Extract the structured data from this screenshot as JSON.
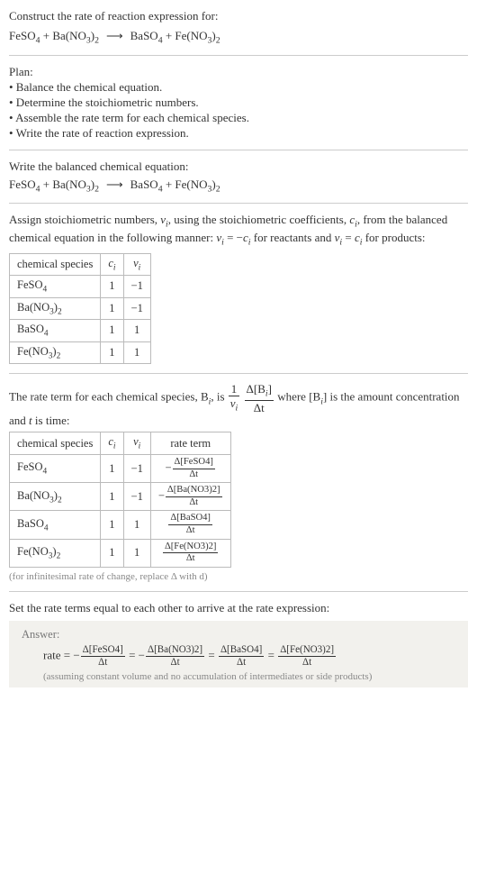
{
  "header": {
    "prompt": "Construct the rate of reaction expression for:"
  },
  "reaction": {
    "r1": "FeSO",
    "r1s": "4",
    "r2": "Ba(NO",
    "r2s": "3",
    "r2b": ")",
    "r2s2": "2",
    "p1": "BaSO",
    "p1s": "4",
    "p2": "Fe(NO",
    "p2s": "3",
    "p2b": ")",
    "p2s2": "2",
    "plus": " + ",
    "arrow": "⟶"
  },
  "plan": {
    "title": "Plan:",
    "b1": "• Balance the chemical equation.",
    "b2": "• Determine the stoichiometric numbers.",
    "b3": "• Assemble the rate term for each chemical species.",
    "b4": "• Write the rate of reaction expression."
  },
  "balanced_label": "Write the balanced chemical equation:",
  "stoich_para": {
    "t1": "Assign stoichiometric numbers, ",
    "nu": "ν",
    "i": "i",
    "t2": ", using the stoichiometric coefficients, ",
    "c": "c",
    "t3": ", from the balanced chemical equation in the following manner: ",
    "eq1a": " = −",
    "t4": " for reactants and ",
    "eq2a": " = ",
    "t5": " for products:"
  },
  "table1": {
    "h1": "chemical species",
    "h2": "c",
    "h2s": "i",
    "h3": "ν",
    "h3s": "i",
    "r": [
      {
        "sp": "FeSO",
        "sps": "4",
        "c": "1",
        "nu": "−1"
      },
      {
        "sp": "Ba(NO",
        "sps": "3",
        "spb": ")",
        "sps2": "2",
        "c": "1",
        "nu": "−1"
      },
      {
        "sp": "BaSO",
        "sps": "4",
        "c": "1",
        "nu": "1"
      },
      {
        "sp": "Fe(NO",
        "sps": "3",
        "spb": ")",
        "sps2": "2",
        "c": "1",
        "nu": "1"
      }
    ]
  },
  "rate_para": {
    "t1": "The rate term for each chemical species, B",
    "t2": ", is ",
    "one": "1",
    "nu": "ν",
    "dB": "Δ[B",
    "dBclose": "]",
    "dt": "Δt",
    "t3": " where [B",
    "t4": "] is the amount concentration and ",
    "tvar": "t",
    "t5": " is time:"
  },
  "table2": {
    "h1": "chemical species",
    "h2": "c",
    "h3": "ν",
    "h4": "rate term",
    "r": [
      {
        "sp": "FeSO",
        "sps": "4",
        "c": "1",
        "nu": "−1",
        "neg": "−",
        "num": "Δ[FeSO4]",
        "den": "Δt"
      },
      {
        "sp": "Ba(NO",
        "sps": "3",
        "spb": ")",
        "sps2": "2",
        "c": "1",
        "nu": "−1",
        "neg": "−",
        "num": "Δ[Ba(NO3)2]",
        "den": "Δt"
      },
      {
        "sp": "BaSO",
        "sps": "4",
        "c": "1",
        "nu": "1",
        "neg": "",
        "num": "Δ[BaSO4]",
        "den": "Δt"
      },
      {
        "sp": "Fe(NO",
        "sps": "3",
        "spb": ")",
        "sps2": "2",
        "c": "1",
        "nu": "1",
        "neg": "",
        "num": "Δ[Fe(NO3)2]",
        "den": "Δt"
      }
    ]
  },
  "inf_note": "(for infinitesimal rate of change, replace Δ with d)",
  "final_label": "Set the rate terms equal to each other to arrive at the rate expression:",
  "answer": {
    "label": "Answer:",
    "rate": "rate",
    "eq": " = ",
    "neg": "−",
    "dt": "Δt",
    "num1": "Δ[FeSO4]",
    "num2": "Δ[Ba(NO3)2]",
    "num3": "Δ[BaSO4]",
    "num4": "Δ[Fe(NO3)2]",
    "note": "(assuming constant volume and no accumulation of intermediates or side products)"
  }
}
